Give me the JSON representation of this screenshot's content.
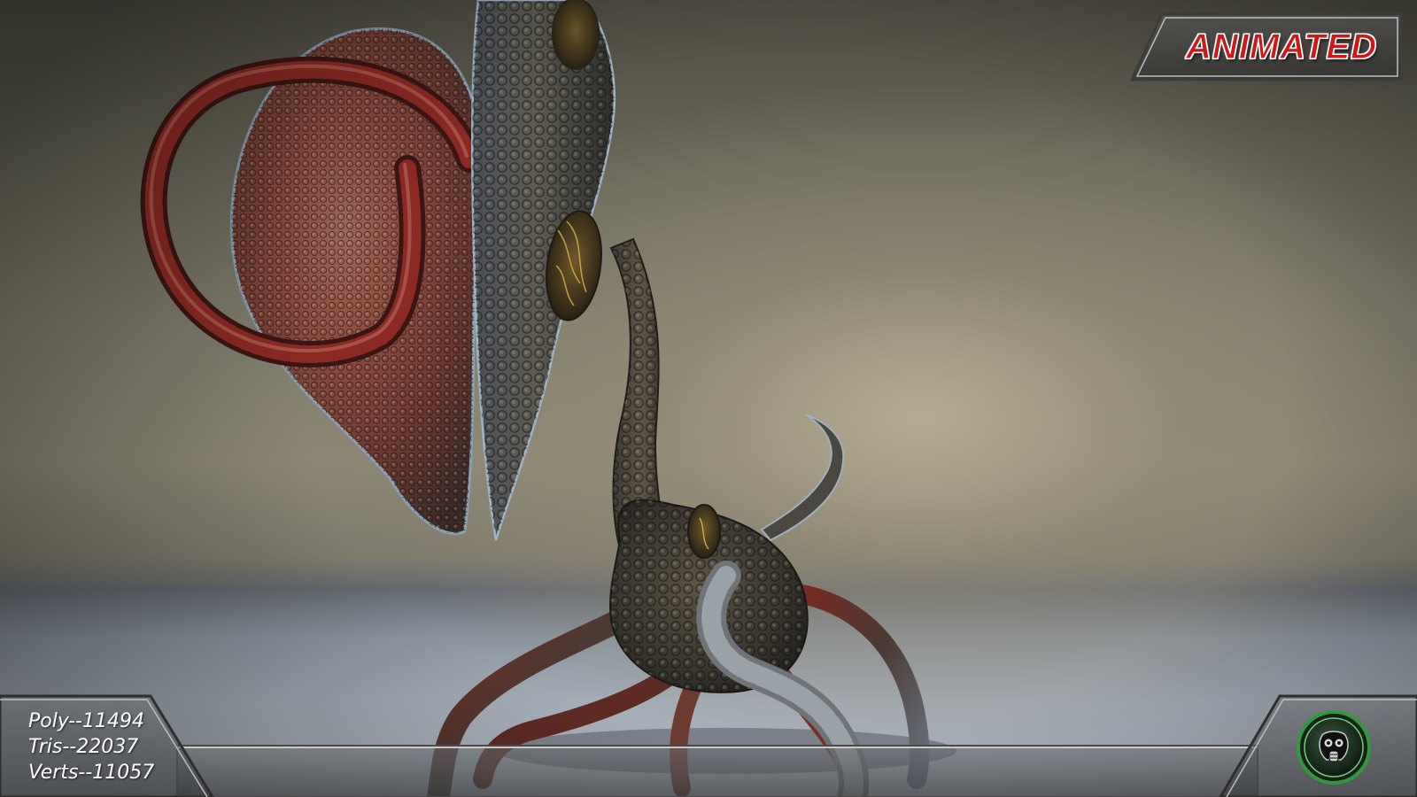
{
  "badge": {
    "label": "ANIMATED",
    "text_color": "#d01818"
  },
  "stats": {
    "poly": "Poly--11494",
    "tris": "Tris--22037",
    "verts": "Verts--11057"
  },
  "logo": {
    "icon": "gas-mask-icon",
    "ring_color": "#2e9a3c"
  },
  "scene": {
    "subject": "alien-creature-model"
  }
}
